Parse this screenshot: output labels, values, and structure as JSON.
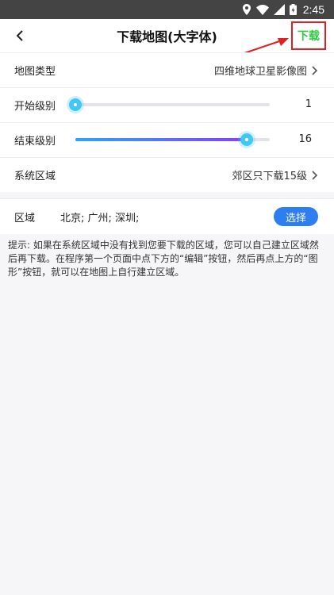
{
  "status_bar": {
    "time": "2:45"
  },
  "toolbar": {
    "title": "下载地图(大字体)",
    "download_label": "下载"
  },
  "rows": {
    "map_type": {
      "label": "地图类型",
      "value": "四维地球卫星影像图"
    },
    "start_level": {
      "label": "开始级别",
      "value": 1,
      "value_text": "1",
      "min": 1,
      "max": 18
    },
    "end_level": {
      "label": "结束级别",
      "value": 16,
      "value_text": "16",
      "min": 1,
      "max": 18
    },
    "system_region": {
      "label": "系统区域",
      "value": "郊区只下载15级"
    },
    "region": {
      "label": "区域",
      "value": "北京; 广州; 深圳;",
      "button": "选择"
    }
  },
  "tip": "提示: 如果在系统区域中没有找到您要下载的区域，您可以自己建立区域然后再下载。在程序第一个页面中点下方的“编辑”按钮，然后再点上方的“图形”按钮，就可以在地图上自行建立区域。",
  "colors": {
    "accent": "#2d7ef1",
    "download_text": "#2ecc40",
    "highlight": "#e02020"
  }
}
